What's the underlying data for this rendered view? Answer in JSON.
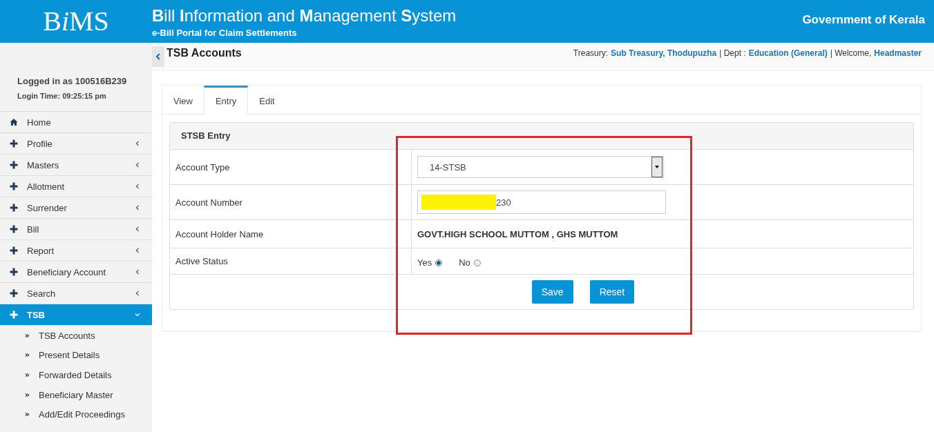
{
  "header": {
    "logo": [
      {
        "text": "B",
        "italic": false
      },
      {
        "text": "i",
        "italic": true
      },
      {
        "text": "MS",
        "italic": false
      }
    ],
    "title": "**B**ill **I**nformation and **M**anagement **S**ystem",
    "subtitle": "e-Bill Portal for Claim Settlements",
    "government": "Government of Kerala"
  },
  "user": {
    "logged_in": "Logged in as 100516B239",
    "login_time": "Login Time: 09:25:15 pm"
  },
  "sidebar": {
    "items": [
      {
        "label": "Home",
        "kind": "home",
        "selected": false
      },
      {
        "label": "Profile",
        "kind": "section",
        "expanded": false,
        "selected": false
      },
      {
        "label": "Masters",
        "kind": "section",
        "expanded": false,
        "selected": false
      },
      {
        "label": "Allotment",
        "kind": "section",
        "expanded": false,
        "selected": false
      },
      {
        "label": "Surrender",
        "kind": "section",
        "expanded": false,
        "selected": false
      },
      {
        "label": "Bill",
        "kind": "section",
        "expanded": false,
        "selected": false
      },
      {
        "label": "Report",
        "kind": "section",
        "expanded": false,
        "selected": false
      },
      {
        "label": "Beneficiary Account",
        "kind": "section",
        "expanded": false,
        "selected": false
      },
      {
        "label": "Search",
        "kind": "section",
        "expanded": false,
        "selected": false
      },
      {
        "label": "TSB",
        "kind": "section",
        "expanded": true,
        "selected": true,
        "children": [
          {
            "label": "TSB Accounts"
          },
          {
            "label": "Present Details"
          },
          {
            "label": "Forwarded Details"
          },
          {
            "label": "Beneficiary Master"
          },
          {
            "label": "Add/Edit Proceedings"
          }
        ]
      }
    ]
  },
  "page": {
    "title": "TSB Accounts",
    "treasury_label": "Treasury:",
    "treasury": "Sub Treasury, Thodupuzha",
    "dept_label": "| Dept :",
    "dept": "Education (General)",
    "welcome_label": "| Welcome,",
    "welcome": "Headmaster"
  },
  "tabs": [
    {
      "label": "View",
      "selected": false
    },
    {
      "label": "Entry",
      "selected": true
    },
    {
      "label": "Edit",
      "selected": false
    }
  ],
  "form": {
    "title": "STSB Entry",
    "rows": [
      {
        "label": "Account Type",
        "kind": "select",
        "value": "14-STSB"
      },
      {
        "label": "Account Number",
        "kind": "input",
        "value": "230",
        "redacted": true
      },
      {
        "label": "Account Holder Name",
        "kind": "text",
        "value": "GOVT.HIGH SCHOOL MUTTOM , GHS MUTTOM"
      },
      {
        "label": "Active Status",
        "kind": "radio",
        "options": [
          {
            "label": "Yes",
            "selected": true
          },
          {
            "label": "No",
            "selected": false
          }
        ]
      }
    ],
    "buttons": [
      "Save",
      "Reset"
    ]
  },
  "annotation": {
    "kind": "highlight-rectangle"
  }
}
